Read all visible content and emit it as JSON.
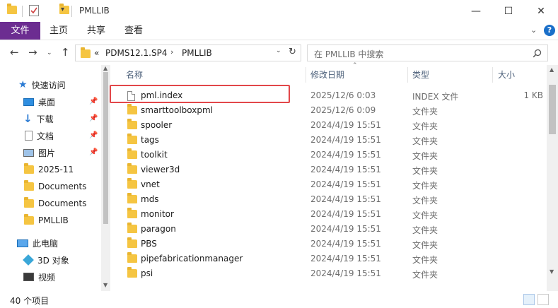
{
  "window": {
    "title": "PMLLIB",
    "minimize": "—",
    "maximize": "☐",
    "close": "✕"
  },
  "ribbon": {
    "tabs": [
      "文件",
      "主页",
      "共享",
      "查看"
    ],
    "expand_glyph": "⌄",
    "help_glyph": "?"
  },
  "address": {
    "overflow": "«",
    "crumbs": [
      "PDMS12.1.SP4",
      "PMLLIB"
    ],
    "search_placeholder": "在 PMLLIB 中搜索"
  },
  "nav": {
    "items": [
      {
        "label": "快速访问",
        "icon": "star-icon",
        "pinned": false
      },
      {
        "label": "桌面",
        "icon": "desktop-icon",
        "pinned": true
      },
      {
        "label": "下载",
        "icon": "download-icon",
        "pinned": true
      },
      {
        "label": "文档",
        "icon": "documents-icon",
        "pinned": true
      },
      {
        "label": "图片",
        "icon": "pictures-icon",
        "pinned": true
      },
      {
        "label": "2025-11",
        "icon": "folder-icon",
        "pinned": false
      },
      {
        "label": "Documents",
        "icon": "folder-icon",
        "pinned": false
      },
      {
        "label": "Documents",
        "icon": "folder-icon",
        "pinned": false
      },
      {
        "label": "PMLLIB",
        "icon": "folder-icon",
        "pinned": false
      },
      {
        "label": "此电脑",
        "icon": "computer-icon",
        "pinned": false
      },
      {
        "label": "3D 对象",
        "icon": "3d-objects-icon",
        "pinned": false
      },
      {
        "label": "视频",
        "icon": "video-icon",
        "pinned": false
      }
    ]
  },
  "columns": {
    "name": "名称",
    "date": "修改日期",
    "type": "类型",
    "size": "大小"
  },
  "files": [
    {
      "name": "pml.index",
      "date": "2025/12/6 0:03",
      "type": "INDEX 文件",
      "size": "1 KB",
      "icon": "file-icon"
    },
    {
      "name": "smarttoolboxpml",
      "date": "2025/12/6 0:09",
      "type": "文件夹",
      "size": "",
      "icon": "folder-icon"
    },
    {
      "name": "spooler",
      "date": "2024/4/19 15:51",
      "type": "文件夹",
      "size": "",
      "icon": "folder-icon"
    },
    {
      "name": "tags",
      "date": "2024/4/19 15:51",
      "type": "文件夹",
      "size": "",
      "icon": "folder-icon"
    },
    {
      "name": "toolkit",
      "date": "2024/4/19 15:51",
      "type": "文件夹",
      "size": "",
      "icon": "folder-icon"
    },
    {
      "name": "viewer3d",
      "date": "2024/4/19 15:51",
      "type": "文件夹",
      "size": "",
      "icon": "folder-icon"
    },
    {
      "name": "vnet",
      "date": "2024/4/19 15:51",
      "type": "文件夹",
      "size": "",
      "icon": "folder-icon"
    },
    {
      "name": "mds",
      "date": "2024/4/19 15:51",
      "type": "文件夹",
      "size": "",
      "icon": "folder-icon"
    },
    {
      "name": "monitor",
      "date": "2024/4/19 15:51",
      "type": "文件夹",
      "size": "",
      "icon": "folder-icon"
    },
    {
      "name": "paragon",
      "date": "2024/4/19 15:51",
      "type": "文件夹",
      "size": "",
      "icon": "folder-icon"
    },
    {
      "name": "PBS",
      "date": "2024/4/19 15:51",
      "type": "文件夹",
      "size": "",
      "icon": "folder-icon"
    },
    {
      "name": "pipefabricationmanager",
      "date": "2024/4/19 15:51",
      "type": "文件夹",
      "size": "",
      "icon": "folder-icon"
    },
    {
      "name": "psi",
      "date": "2024/4/19 15:51",
      "type": "文件夹",
      "size": "",
      "icon": "folder-icon"
    }
  ],
  "status": {
    "item_count": "40 个项目"
  },
  "colors": {
    "file_tab": "#6c2d91",
    "highlight": "#e2474a",
    "folder": "#f5c542",
    "accent": "#1a6fc9"
  }
}
